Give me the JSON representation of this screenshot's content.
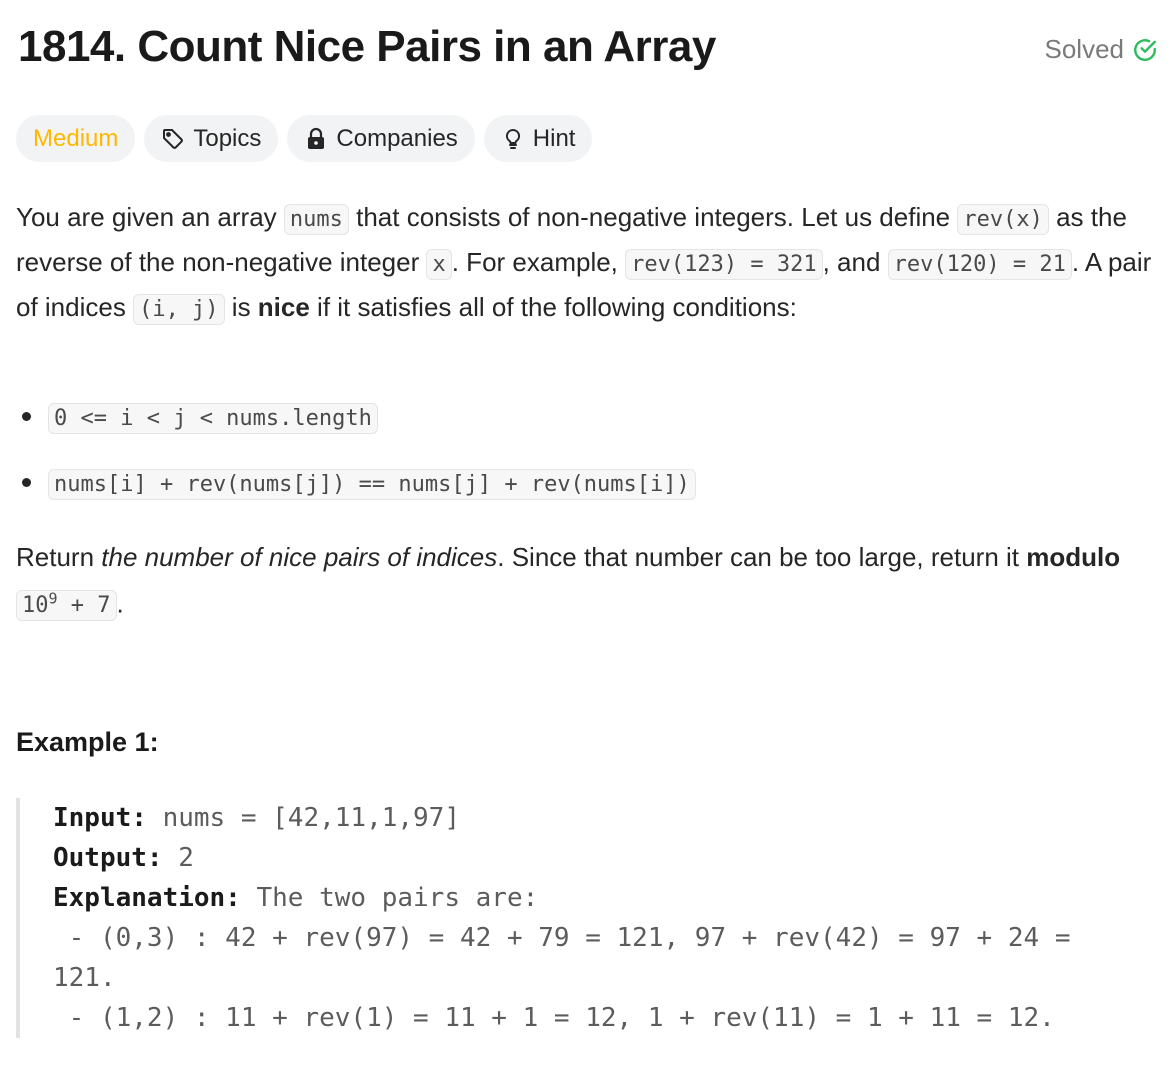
{
  "problem": {
    "title": "1814. Count Nice Pairs in an Array",
    "status": "Solved"
  },
  "pills": {
    "difficulty": "Medium",
    "topics": "Topics",
    "companies": "Companies",
    "hint": "Hint"
  },
  "description": {
    "t1": "You are given an array ",
    "c1": "nums",
    "t2": " that consists of non-negative integers. Let us define ",
    "c2": "rev(x)",
    "t3": " as the reverse of the non-negative integer ",
    "c3": "x",
    "t4": ". For example, ",
    "c4": "rev(123) = 321",
    "t5": ", and ",
    "c5": "rev(120) = 21",
    "t6": ". A pair of indices ",
    "c6": "(i, j)",
    "t7": " is ",
    "b1": "nice",
    "t8": " if it satisfies all of the following conditions:"
  },
  "conditions": [
    "0 <= i < j < nums.length",
    "nums[i] + rev(nums[j]) == nums[j] + rev(nums[i])"
  ],
  "return_text": {
    "t1": "Return ",
    "i1": "the number of nice pairs of indices",
    "t2": ". Since that number can be too large, return it ",
    "b1": "modulo",
    "code_base": "10",
    "code_exp": "9",
    "code_rest": " + 7",
    "t3": "."
  },
  "example": {
    "title": "Example 1:",
    "input_label": "Input:",
    "input_value": " nums = [42,11,1,97]",
    "output_label": "Output:",
    "output_value": " 2",
    "explanation_label": "Explanation:",
    "explanation_value": " The two pairs are:",
    "line1": " - (0,3) : 42 + rev(97) = 42 + 79 = 121, 97 + rev(42) = 97 + 24 =",
    "line1b": "121.",
    "line2": " - (1,2) : 11 + rev(1) = 11 + 1 = 12, 1 + rev(11) = 1 + 11 = 12."
  },
  "colors": {
    "medium": "#ffb800",
    "solved_check": "#2cbb5d",
    "pill_bg": "#f2f3f4"
  }
}
